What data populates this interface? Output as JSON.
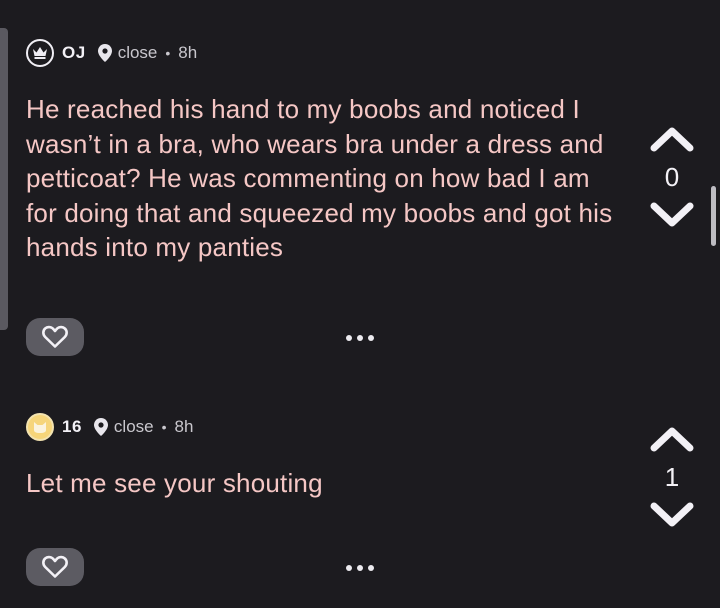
{
  "posts": [
    {
      "username": "OJ",
      "location": "close",
      "separator": "•",
      "time": "8h",
      "text": "He reached his hand to my boobs and noticed I wasn’t in a bra, who wears bra under a dress and petticoat? He was commenting on how bad I am for doing that and squeezed my boobs and got his hands into my panties",
      "votes": "0",
      "badge_icon": "crown-icon"
    },
    {
      "username": "16",
      "location": "close",
      "separator": "•",
      "time": "8h",
      "text": "Let me see your shouting",
      "votes": "1",
      "badge_icon": "cat-icon",
      "badge_color": "#f6d57a"
    }
  ],
  "colors": {
    "background": "#1c1b1f",
    "post_text": "#f5c7c5",
    "button_bg": "#5c5b62"
  }
}
